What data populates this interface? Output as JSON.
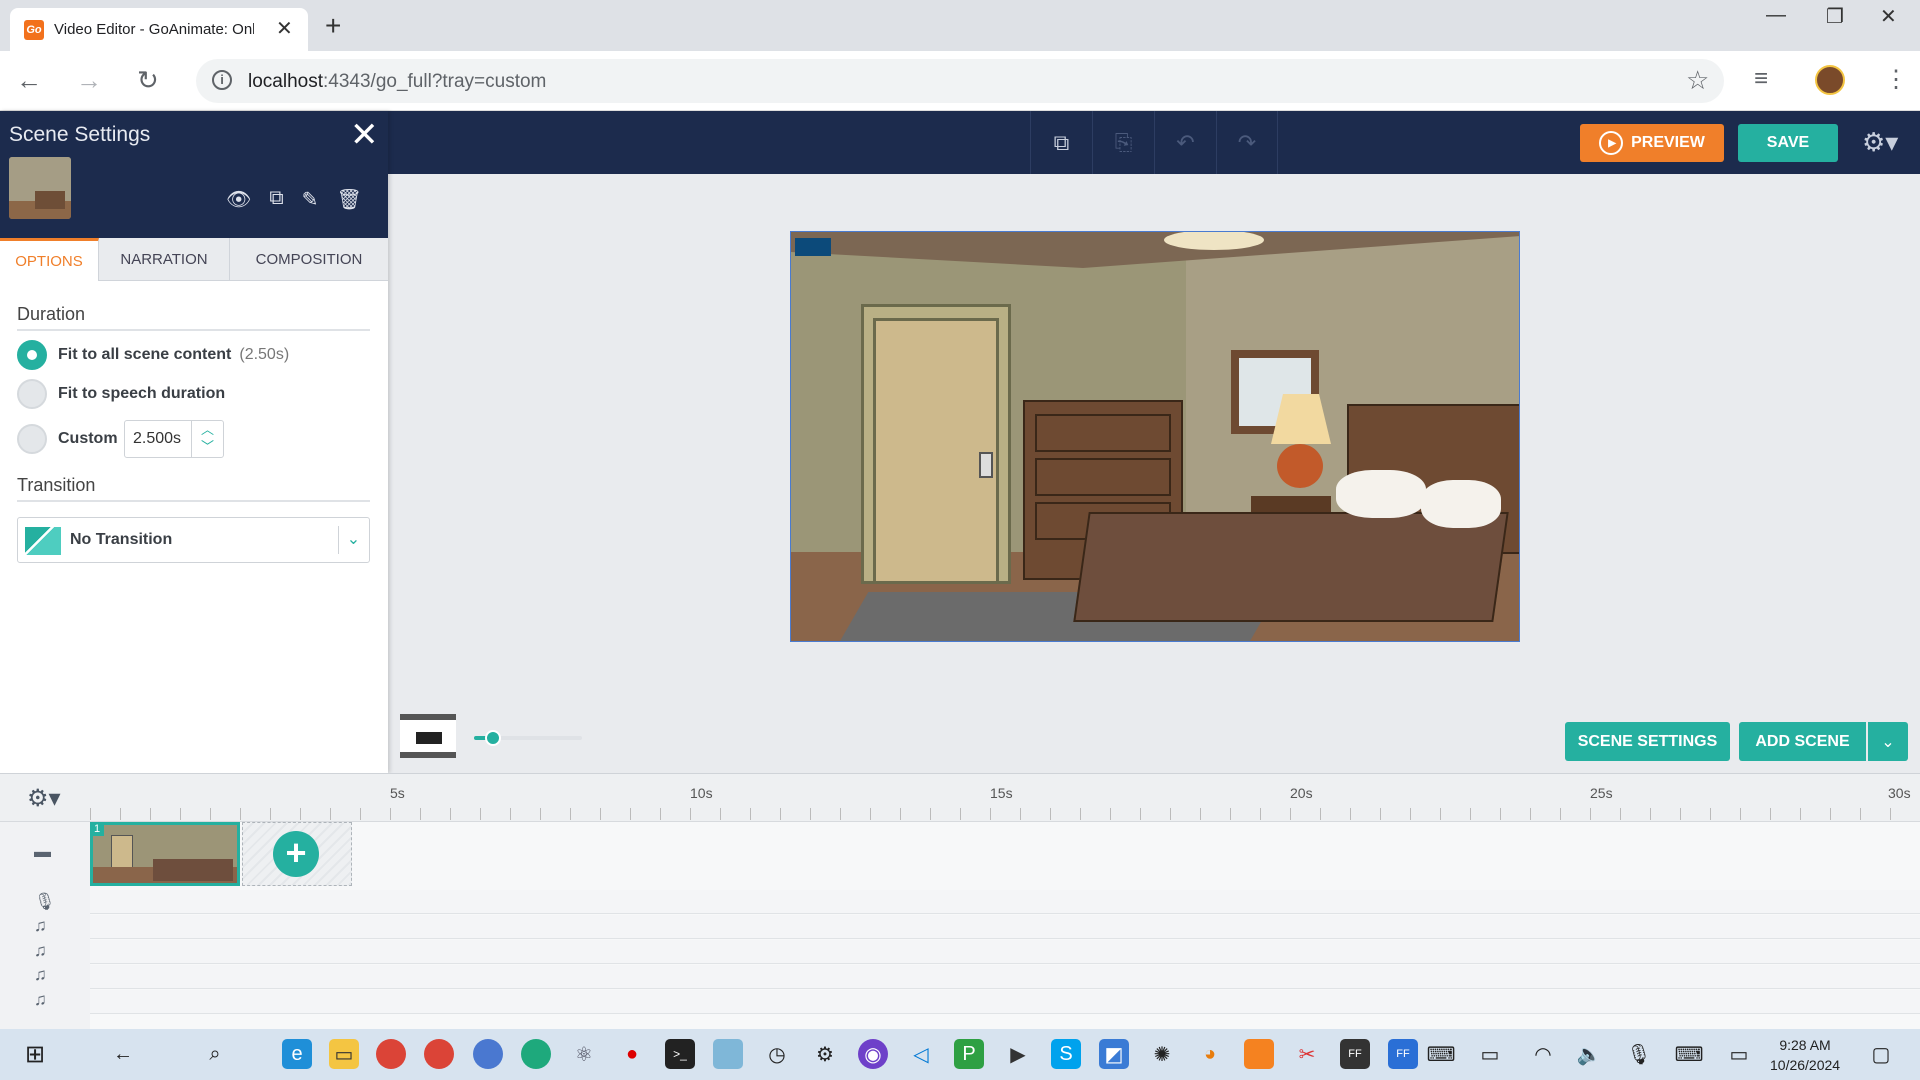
{
  "browser": {
    "tab_title": "Video Editor - GoAnimate: Onli",
    "favicon_text": "Go",
    "url_host": "localhost",
    "url_path": ":4343/go_full?tray=custom"
  },
  "toolbar": {
    "preview_label": "PREVIEW",
    "save_label": "SAVE"
  },
  "panel": {
    "title": "Scene Settings",
    "tabs": [
      {
        "label": "OPTIONS",
        "active": true
      },
      {
        "label": "NARRATION",
        "active": false
      },
      {
        "label": "COMPOSITION",
        "active": false
      }
    ],
    "duration": {
      "title": "Duration",
      "options": [
        {
          "label": "Fit to all scene content",
          "sub": "(2.50s)",
          "checked": true
        },
        {
          "label": "Fit to speech duration",
          "sub": "",
          "checked": false
        },
        {
          "label": "Custom",
          "sub": "",
          "checked": false
        }
      ],
      "custom_value": "2.500s"
    },
    "transition": {
      "title": "Transition",
      "selected": "No Transition"
    }
  },
  "stage": {
    "scene_settings_label": "SCENE SETTINGS",
    "add_scene_label": "ADD SCENE",
    "zoom_level": 0.15
  },
  "timeline": {
    "ruler_labels": [
      "5s",
      "10s",
      "15s",
      "20s",
      "25s",
      "30s"
    ],
    "scene_number": "1",
    "tracks": [
      "camera-icon",
      "microphone-icon",
      "music-note-icon",
      "music-note-icon",
      "music-note-icon",
      "music-note-icon"
    ]
  },
  "taskbar": {
    "time": "9:28 AM",
    "date": "10/26/2024"
  },
  "colors": {
    "accent_teal": "#25b0a0",
    "accent_orange": "#f07f2a",
    "navy": "#1c2b4d"
  }
}
